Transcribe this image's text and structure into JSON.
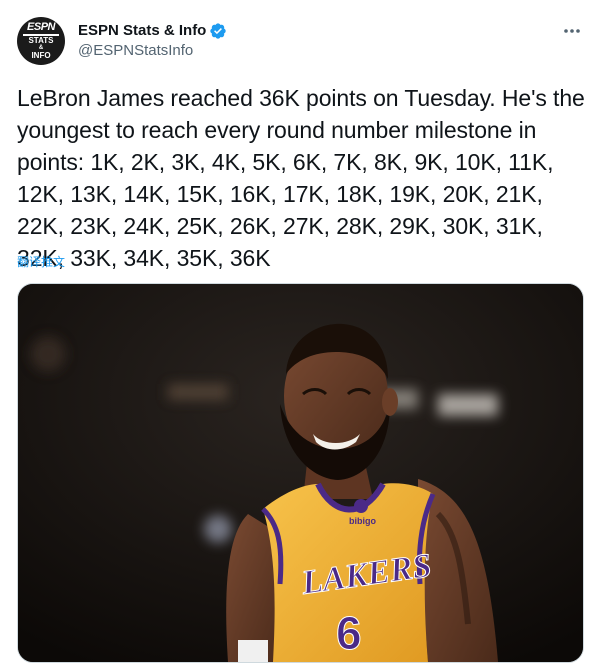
{
  "author": {
    "display_name": "ESPN Stats & Info",
    "handle": "@ESPNStatsInfo",
    "verified": true,
    "avatar_text": {
      "logo": "ESPN",
      "line1": "STATS",
      "line2": "&",
      "line3": "INFO"
    }
  },
  "tweet": {
    "text": "LeBron James reached 36K points on Tuesday. He's the youngest to reach every round number milestone in points: 1K, 2K, 3K, 4K, 5K, 6K, 7K, 8K, 9K, 10K, 11K, 12K, 13K, 14K, 15K, 16K, 17K, 18K, 19K, 20K, 21K, 22K, 23K, 24K, 25K, 26K, 27K, 28K, 29K, 30K, 31K, 32K, 33K, 34K, 35K, 36K",
    "translate_label": "翻译推文"
  },
  "media": {
    "jersey_wordmark": "LAKERS",
    "jersey_number": "6",
    "sponsor_patch": "bibigo"
  },
  "icons": {
    "verified": "verified-badge-icon",
    "more": "more-options-icon"
  },
  "colors": {
    "link": "#1d9bf0",
    "secondary_text": "#536471",
    "verified": "#1d9bf0",
    "jersey_gold": "#f2b33a",
    "jersey_purple": "#4b2a87"
  }
}
